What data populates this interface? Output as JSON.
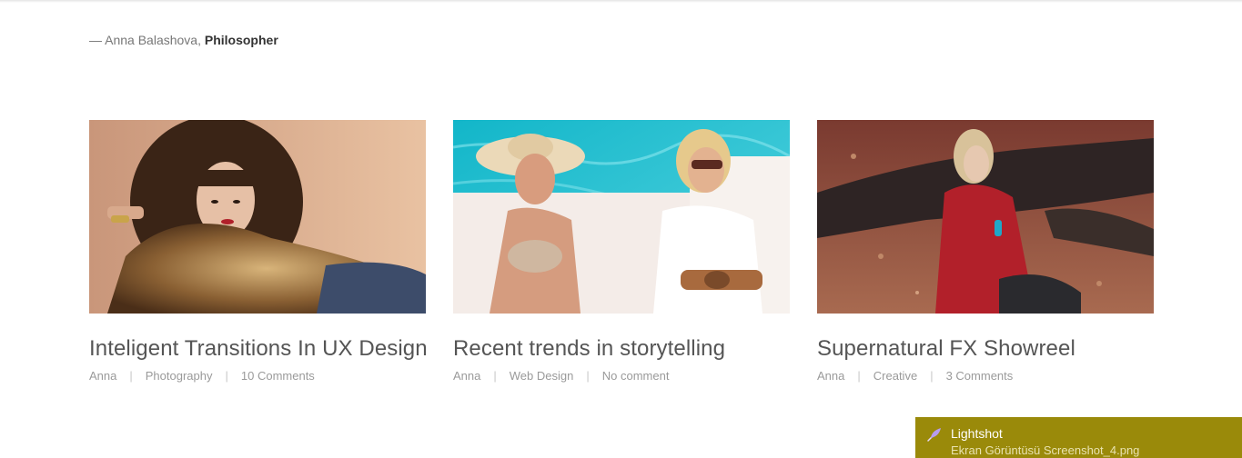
{
  "quote": {
    "prefix": "— Anna Balashova,",
    "role": "Philosopher"
  },
  "posts": [
    {
      "image_alt": "fashion model in fur coat",
      "title": "Inteligent Transitions In UX Design",
      "author": "Anna",
      "category": "Photography",
      "comments": "10 Comments"
    },
    {
      "image_alt": "two models by the pool",
      "title": "Recent trends in storytelling",
      "author": "Anna",
      "category": "Web Design",
      "comments": "No comment"
    },
    {
      "image_alt": "model in red sweater in autumn forest",
      "title": "Supernatural FX Showreel",
      "author": "Anna",
      "category": "Creative",
      "comments": "3 Comments"
    }
  ],
  "meta_separator": "|",
  "lightshot": {
    "title": "Lightshot",
    "filename": "Ekran Görüntüsü Screenshot_4.png",
    "icon": "feather-icon",
    "bg_color": "#9a8a0a"
  }
}
